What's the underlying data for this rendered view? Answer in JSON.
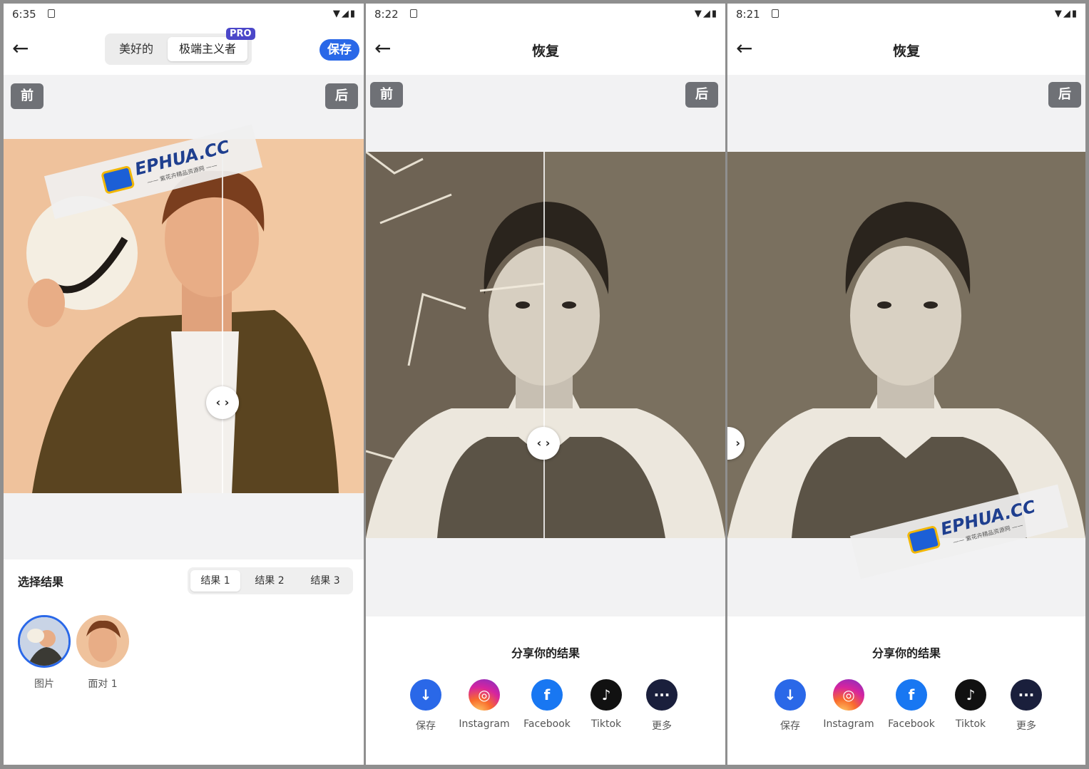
{
  "screens": [
    {
      "time": "6:35",
      "mode_tabs": {
        "normal": "美好的",
        "extreme": "极端主义者"
      },
      "pro_badge": "PRO",
      "save_label": "保存",
      "before_label": "前",
      "after_label": "后",
      "watermark": {
        "brand": "EPHUA.CC",
        "sub": "—— 紫花卉精品资源网 ——"
      },
      "result_title": "选择结果",
      "result_tabs": [
        "结果 1",
        "结果 2",
        "结果 3"
      ],
      "thumbnails": [
        {
          "label": "图片"
        },
        {
          "label": "面对 1"
        }
      ]
    },
    {
      "time": "8:22",
      "title": "恢复",
      "before_label": "前",
      "after_label": "后",
      "share_title": "分享你的结果",
      "share": [
        {
          "label": "保存",
          "icon": "download-icon",
          "color": "#2a68e8"
        },
        {
          "label": "Instagram",
          "icon": "instagram-icon"
        },
        {
          "label": "Facebook",
          "icon": "facebook-icon",
          "color": "#1877f2"
        },
        {
          "label": "Tiktok",
          "icon": "tiktok-icon",
          "color": "#111111"
        },
        {
          "label": "更多",
          "icon": "more-icon",
          "color": "#1a1f3c"
        }
      ]
    },
    {
      "time": "8:21",
      "title": "恢复",
      "after_label": "后",
      "watermark": {
        "brand": "EPHUA.CC",
        "sub": "—— 紫花卉精品资源网 ——"
      },
      "share_title": "分享你的结果",
      "share": [
        {
          "label": "保存",
          "icon": "download-icon",
          "color": "#2a68e8"
        },
        {
          "label": "Instagram",
          "icon": "instagram-icon"
        },
        {
          "label": "Facebook",
          "icon": "facebook-icon",
          "color": "#1877f2"
        },
        {
          "label": "Tiktok",
          "icon": "tiktok-icon",
          "color": "#111111"
        },
        {
          "label": "更多",
          "icon": "more-icon",
          "color": "#1a1f3c"
        }
      ]
    }
  ]
}
